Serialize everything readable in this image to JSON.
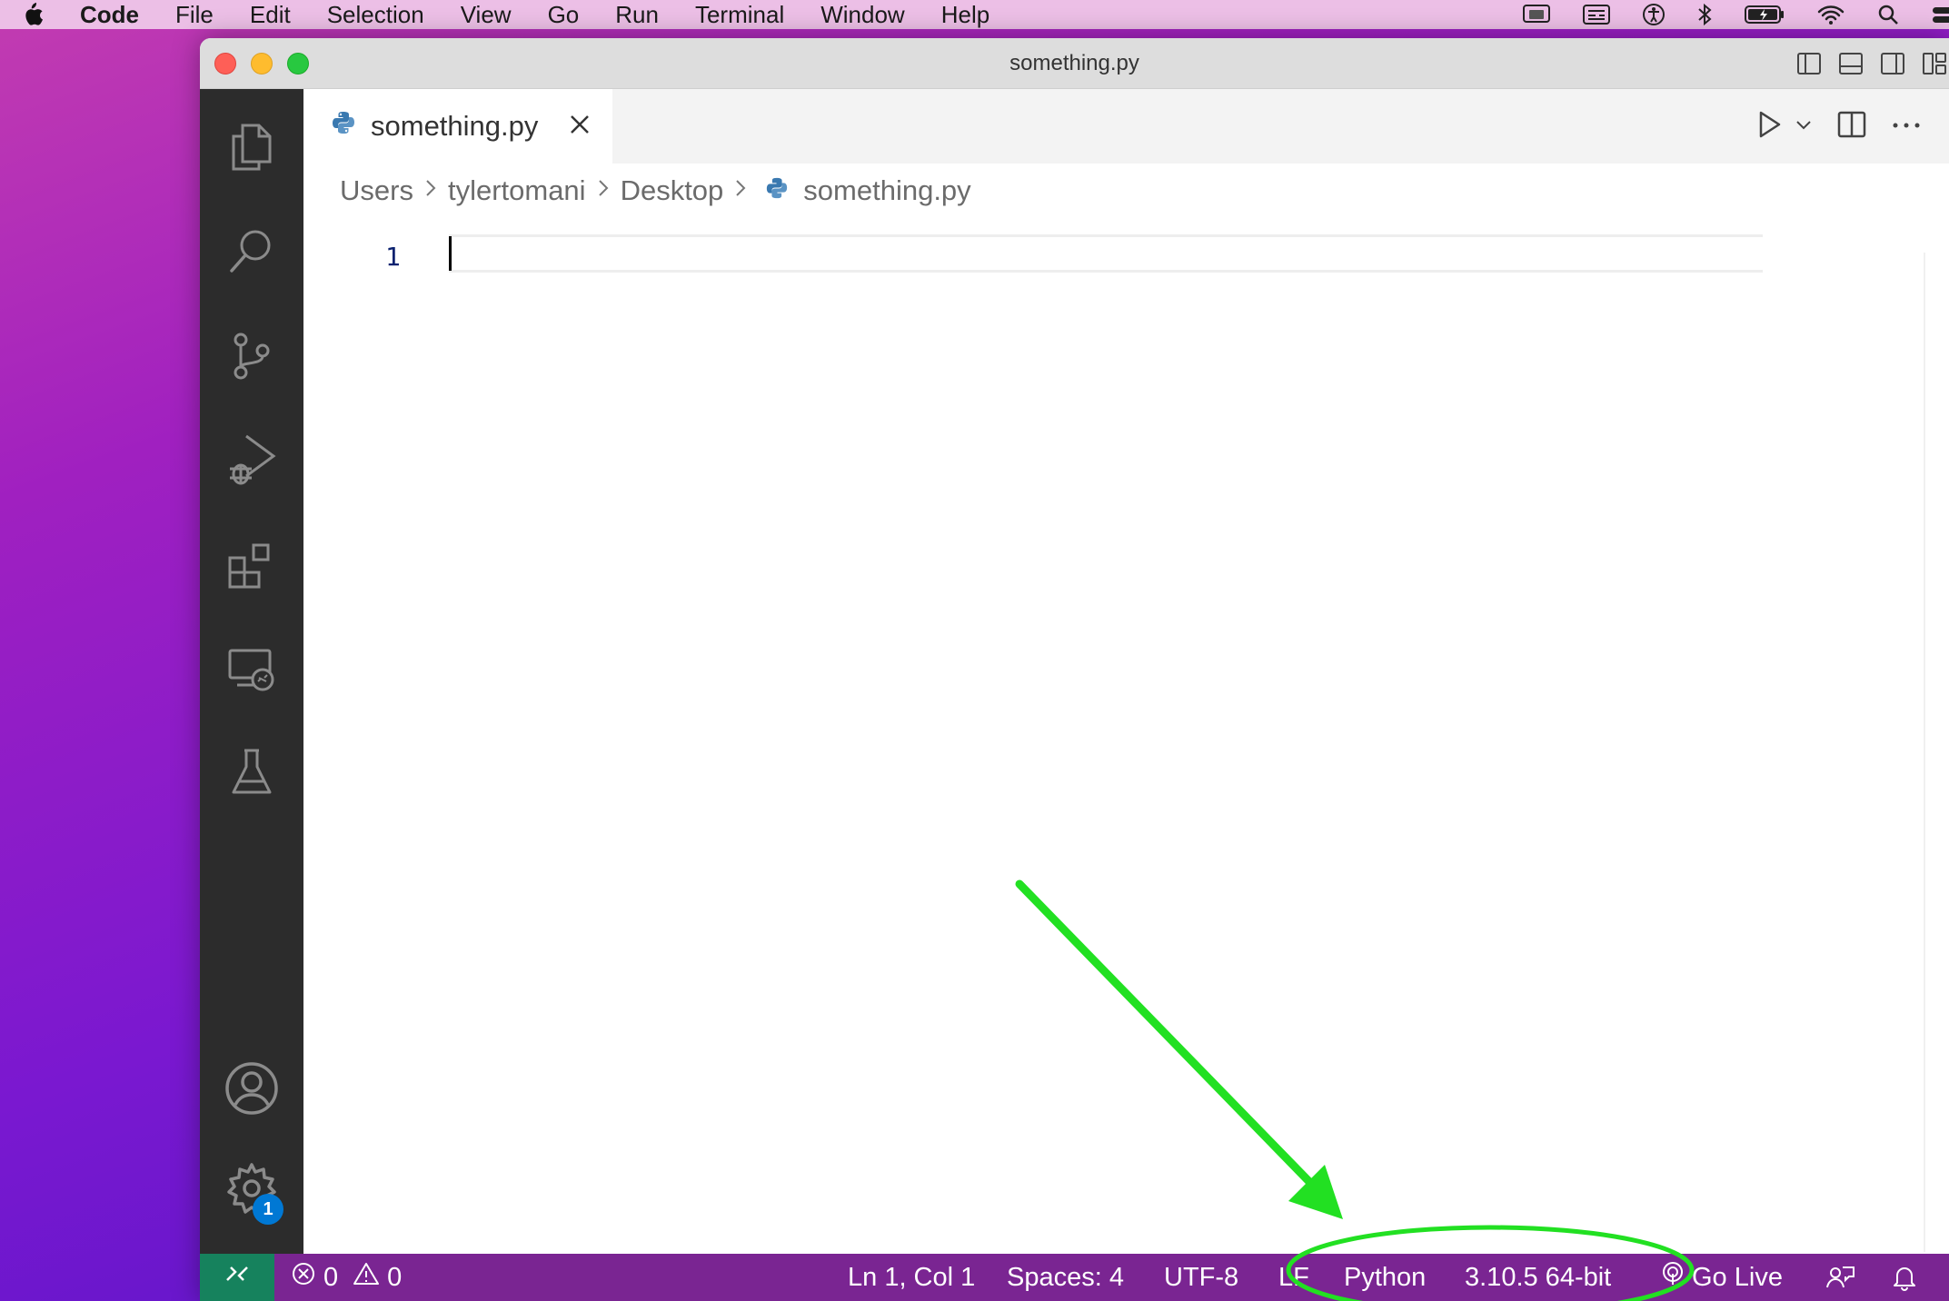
{
  "menubar": {
    "app_name": "Code",
    "items": [
      "File",
      "Edit",
      "Selection",
      "View",
      "Go",
      "Run",
      "Terminal",
      "Window",
      "Help"
    ]
  },
  "window": {
    "title": "something.py"
  },
  "tab": {
    "label": "something.py",
    "icon": "python-icon"
  },
  "breadcrumb": {
    "segments": [
      "Users",
      "tylertomani",
      "Desktop",
      "something.py"
    ]
  },
  "editor": {
    "line_numbers": [
      "1"
    ]
  },
  "activity": {
    "settings_badge": "1"
  },
  "statusbar": {
    "errors": "0",
    "warnings": "0",
    "position": "Ln 1, Col 1",
    "spaces": "Spaces: 4",
    "encoding": "UTF-8",
    "eol": "LF",
    "language": "Python",
    "interpreter": "3.10.5 64-bit",
    "go_live": "Go Live"
  },
  "colors": {
    "statusbar_bg": "#7a2592",
    "remote_bg": "#16825d",
    "activitybar_bg": "#2c2c2c",
    "annotation": "#22e022",
    "badge": "#0078d4"
  }
}
